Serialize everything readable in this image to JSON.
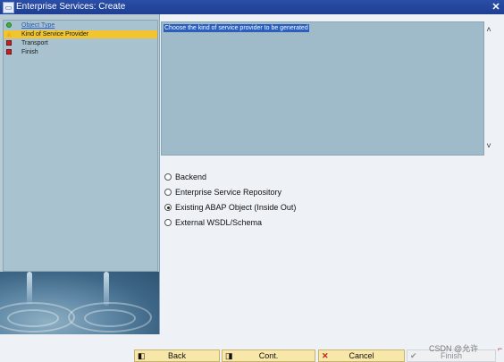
{
  "window": {
    "title": "Enterprise Services: Create",
    "close_glyph": "✕"
  },
  "steps": [
    {
      "label": "Object Type",
      "status": "done",
      "icon": "green-circle-icon"
    },
    {
      "label": "Kind of Service Provider",
      "status": "current",
      "icon": "yellow-triangle-icon"
    },
    {
      "label": "Transport",
      "status": "pending",
      "icon": "red-square-icon"
    },
    {
      "label": "Finish",
      "status": "pending",
      "icon": "red-square-icon"
    }
  ],
  "description": {
    "text": "Choose the kind of service provider to be generated"
  },
  "options": [
    {
      "label": "Backend",
      "selected": false
    },
    {
      "label": "Enterprise Service Repository",
      "selected": false
    },
    {
      "label": "Existing ABAP Object (Inside Out)",
      "selected": true
    },
    {
      "label": "External WSDL/Schema",
      "selected": false
    }
  ],
  "buttons": {
    "back": "Back",
    "cont": "Cont.",
    "cancel": "Cancel",
    "finish": "Finish"
  },
  "watermark": "CSDN @允许",
  "colors": {
    "title_bar": "#1e3f92",
    "current_step": "#f2c530",
    "button": "#f7e7a8"
  }
}
